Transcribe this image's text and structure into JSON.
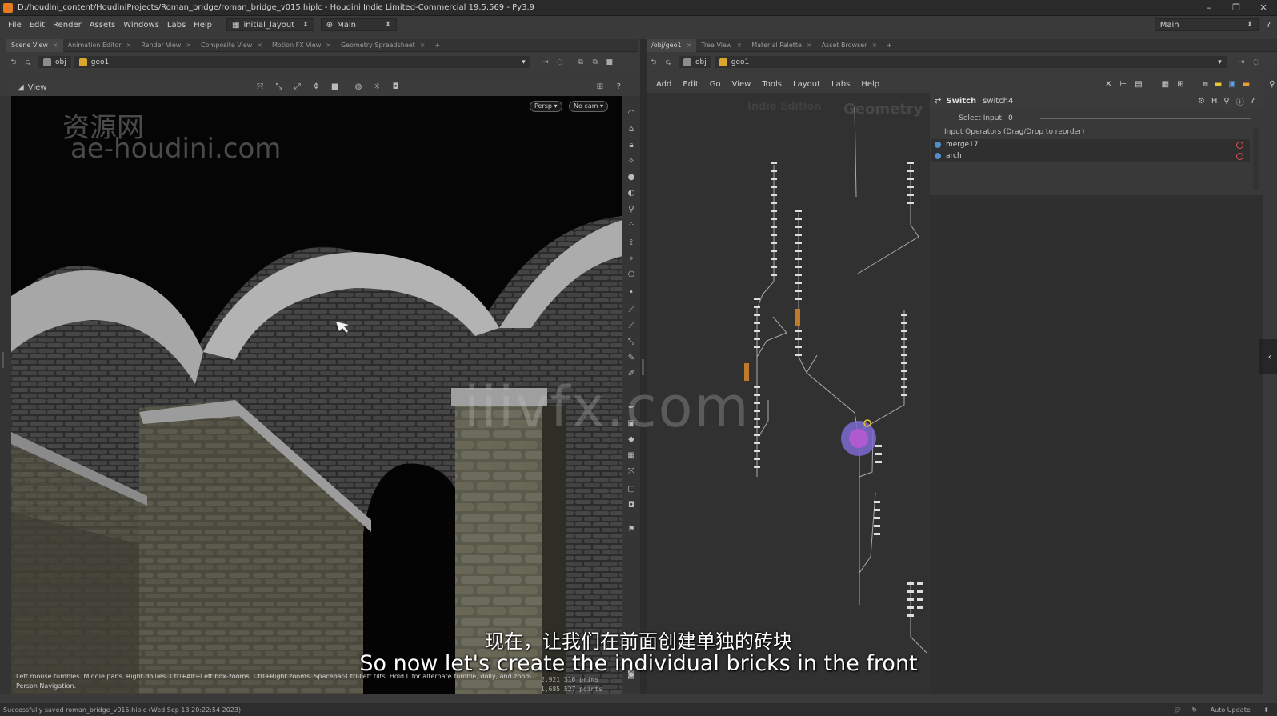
{
  "window": {
    "title": "D:/houdini_content/HoudiniProjects/Roman_bridge/roman_bridge_v015.hiplc - Houdini Indie Limited-Commercial 19.5.569 - Py3.9"
  },
  "menubar": {
    "items": [
      "File",
      "Edit",
      "Render",
      "Assets",
      "Windows",
      "Labs",
      "Help"
    ],
    "layout_selector": "initial_layout",
    "desktop_selector": "Main",
    "right_desktop": "Main"
  },
  "left_pane": {
    "tabs": [
      "Scene View",
      "Animation Editor",
      "Render View",
      "Composite View",
      "Motion FX View",
      "Geometry Spreadsheet"
    ],
    "path": {
      "root": "obj",
      "node": "geo1"
    },
    "view_label": "View",
    "persp_btn": "Persp",
    "cam_btn": "No cam",
    "hint_line1": "Left mouse tumbles. Middle pans. Right dollies. Ctrl+Alt+Left box-zooms. Ctrl+Right zooms. Spacebar-Ctrl-Left tilts. Hold L for alternate tumble, dolly, and zoom.",
    "hint_line2": "Person Navigation.",
    "count_prims": "2,921,316   prims",
    "count_points": "1,685,527  points"
  },
  "right_pane": {
    "tabs": [
      "/obj/geo1",
      "Tree View",
      "Material Palette",
      "Asset Browser"
    ],
    "path": {
      "root": "obj",
      "node": "geo1"
    },
    "net_menu": [
      "Add",
      "Edit",
      "Go",
      "View",
      "Tools",
      "Layout",
      "Labs",
      "Help"
    ],
    "net_label_context": "Indie Edition",
    "net_label_geometry": "Geometry"
  },
  "parameters": {
    "op_type": "Switch",
    "node_name": "switch4",
    "select_input_label": "Select Input",
    "select_input_value": "0",
    "list_header": "Input Operators (Drag/Drop to reorder)",
    "inputs": [
      "merge17",
      "arch"
    ]
  },
  "status": {
    "message": "Successfully saved roman_bridge_v015.hiplc (Wed Sep 13 20:22:54 2023)",
    "auto_update": "Auto Update"
  },
  "overlay": {
    "subtitle_cn": "现在，让我们在前面创建单独的砖块",
    "subtitle_en": "So now let's create the individual bricks in the front",
    "watermark_cn": "资源网",
    "watermark_site": "ae-houdini.com",
    "watermark_center": "iiivfx.com"
  }
}
